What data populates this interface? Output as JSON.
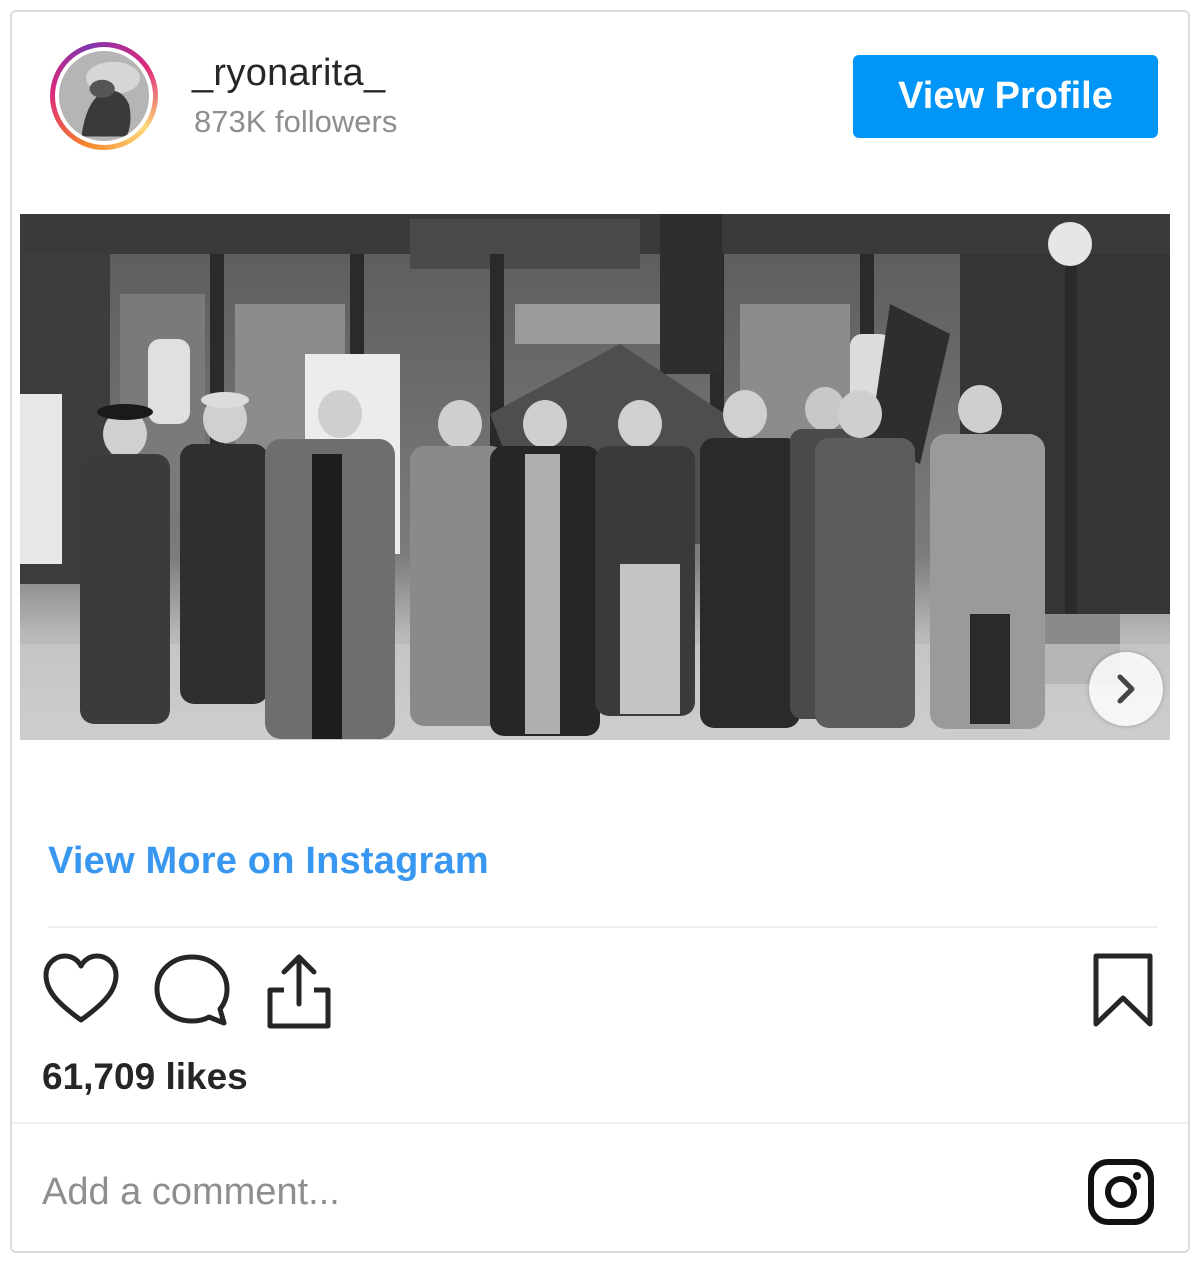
{
  "header": {
    "username": "_ryonarita_",
    "followers": "873K followers",
    "view_profile_label": "View Profile"
  },
  "post": {
    "image_description_icon": "photo",
    "next_icon": "chevron-right-icon",
    "view_more_label": "View More on Instagram",
    "likes": "61,709 likes"
  },
  "actions": {
    "like_icon": "heart-icon",
    "comment_icon": "comment-icon",
    "share_icon": "share-icon",
    "save_icon": "bookmark-icon"
  },
  "comment": {
    "placeholder": "Add a comment..."
  },
  "footer": {
    "logo_icon": "instagram-icon"
  },
  "colors": {
    "accent": "#0095f6",
    "link": "#3897f0",
    "muted": "#8e8e8e",
    "text": "#262626"
  }
}
